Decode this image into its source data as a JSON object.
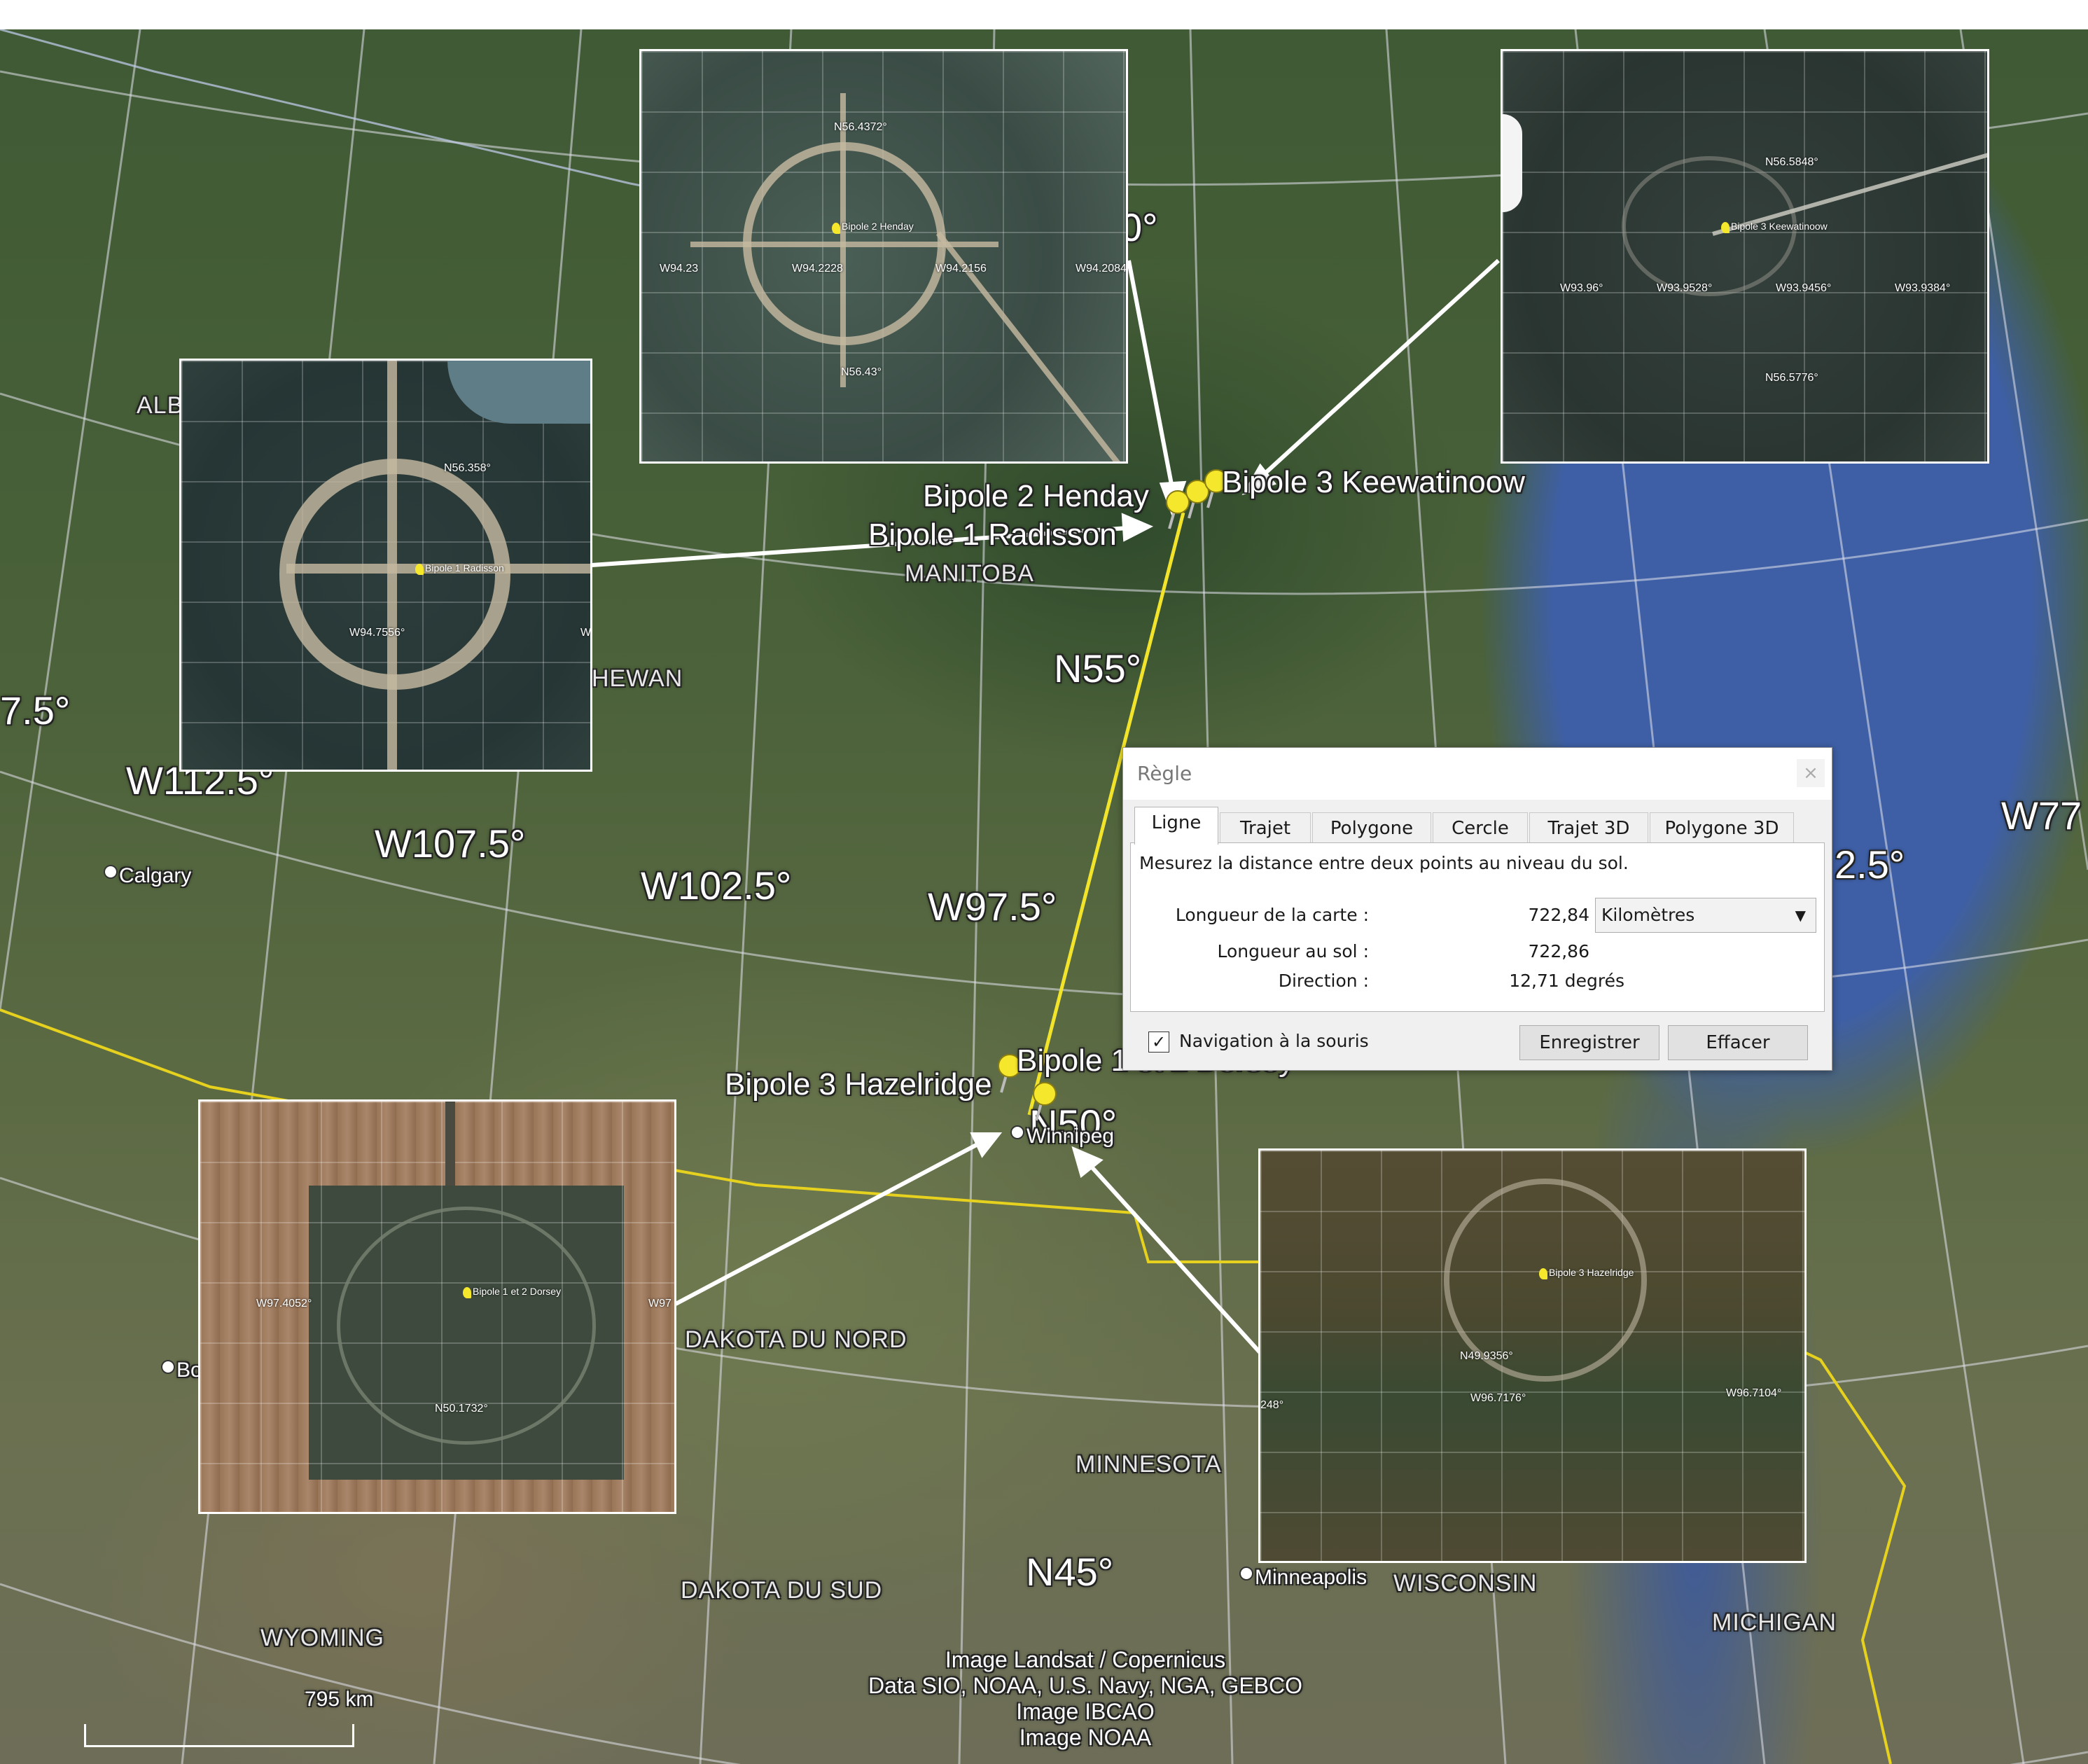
{
  "map": {
    "coord_labels": {
      "n60": "0°",
      "n55": "N55°",
      "n50": "N50°",
      "n45": "N45°",
      "w117": "7.5°",
      "w112": "W112.5°",
      "w107": "W107.5°",
      "w102": "W102.5°",
      "w97": "W97.5°",
      "w87": "2.5°",
      "w77": "W77"
    },
    "regions": {
      "alberta": "ALB",
      "saskatchewan": "HEWAN",
      "manitoba": "MANITOBA",
      "north_dakota": "DAKOTA DU NORD",
      "south_dakota": "DAKOTA DU SUD",
      "minnesota": "MINNESOTA",
      "wisconsin": "WISCONSIN",
      "wyoming": "WYOMING",
      "michigan": "MICHIGAN"
    },
    "cities": {
      "calgary": "Calgary",
      "winnipeg": "Winnipeg",
      "minneapolis": "Minneapolis",
      "bismarck": "Bo"
    },
    "placemarks": {
      "henday": "Bipole 2 Henday",
      "keewatinoow": "Bipole 3 Keewatinoow",
      "radisson": "Bipole 1 Radisson",
      "dorsey": "Bipole 1 et 2 Dorsey",
      "hazelridge": "Bipole 3 Hazelridge"
    },
    "scale": "795  km",
    "credits": [
      "Image Landsat / Copernicus",
      "Data SIO, NOAA, U.S. Navy, NGA, GEBCO",
      "Image IBCAO",
      "Image NOAA"
    ],
    "colors": {
      "measure_line": "#f2e42a",
      "border_line": "#e6d21e",
      "water": "#3e5fa6"
    }
  },
  "insets": {
    "henday": {
      "pin": "Bipole 2 Henday",
      "top": "N56.4372°",
      "bottom": "N56.43°",
      "left": "W94.23",
      "mid": "W94.2228",
      "right": "W94.2156",
      "edge": "W94.2084"
    },
    "keewatinoow": {
      "pin": "Bipole 3 Keewatinoow",
      "top": "N56.5848°",
      "bottom": "N56.5776°",
      "c1": "W93.96°",
      "c2": "W93.9528°",
      "c3": "W93.9456°",
      "c4": "W93.9384°"
    },
    "radisson": {
      "pin": "Bipole 1 Radisson",
      "top": "N56.358°",
      "bottom": "W94.7556°",
      "edge": "W"
    },
    "dorsey": {
      "pin": "Bipole 1 et 2 Dorsey",
      "left": "W97.4052°",
      "right": "W97",
      "bottom": "N50.1732°"
    },
    "hazelridge": {
      "pin": "Bipole 3 Hazelridge",
      "lat": "N49.9356°",
      "w1": "W96.7176°",
      "w2": "W96.7104°",
      "edge": "248°"
    }
  },
  "ruler": {
    "title": "Règle",
    "close": "×",
    "tabs": [
      "Ligne",
      "Trajet",
      "Polygone",
      "Cercle",
      "Trajet 3D",
      "Polygone 3D"
    ],
    "active_tab": "Ligne",
    "description": "Mesurez la distance entre deux points au niveau du sol.",
    "map_length_label": "Longueur de la carte :",
    "map_length_value": "722,84",
    "unit": "Kilomètres",
    "ground_length_label": "Longueur au sol :",
    "ground_length_value": "722,86",
    "direction_label": "Direction :",
    "direction_value": "12,71 degrés",
    "mouse_nav_label": "Navigation à la souris",
    "mouse_nav_checked": "✓",
    "save_button": "Enregistrer",
    "clear_button": "Effacer"
  }
}
